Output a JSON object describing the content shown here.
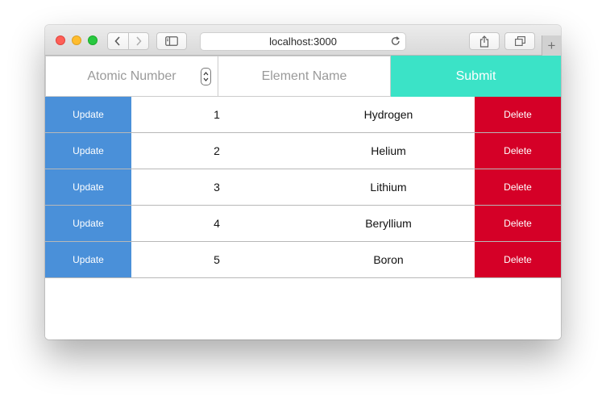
{
  "browser": {
    "url": "localhost:3000"
  },
  "form": {
    "atomic_placeholder": "Atomic Number",
    "name_placeholder": "Element Name",
    "submit_label": "Submit"
  },
  "table": {
    "update_label": "Update",
    "delete_label": "Delete",
    "rows": [
      {
        "number": "1",
        "name": "Hydrogen"
      },
      {
        "number": "2",
        "name": "Helium"
      },
      {
        "number": "3",
        "name": "Lithium"
      },
      {
        "number": "4",
        "name": "Beryllium"
      },
      {
        "number": "5",
        "name": "Boron"
      }
    ]
  },
  "colors": {
    "update": "#4a90d9",
    "delete": "#d50027",
    "submit": "#3be3c7"
  }
}
